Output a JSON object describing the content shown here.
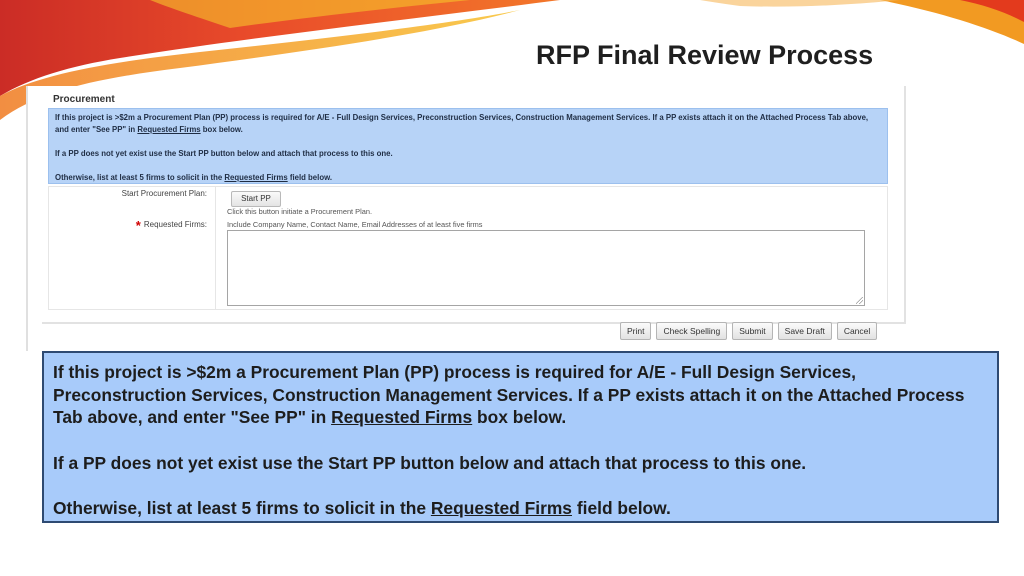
{
  "slide": {
    "title": "RFP Final Review Process"
  },
  "form": {
    "section_title": "Procurement",
    "info": {
      "p1_a": "If this project is >$2m a Procurement Plan (PP) process is required for A/E - Full Design Services, Preconstruction Services, Construction Management Services.  If a PP exists attach it on the Attached Process Tab above, and enter \"See PP\" in ",
      "p1_link": "Requested Firms",
      "p1_b": " box below.",
      "p2": "If a PP does not yet exist use the Start PP button below and attach that process to this one.",
      "p3_a": "Otherwise, list at least 5 firms to solicit in the ",
      "p3_link": "Requested Firms",
      "p3_b": " field below."
    },
    "start_pp_label": "Start Procurement Plan:",
    "start_pp_button": "Start PP",
    "start_pp_hint": "Click this button initiate a Procurement Plan.",
    "required_marker": "*",
    "requested_firms_label": "Requested Firms:",
    "requested_firms_hint": "Include Company Name, Contact Name, Email Addresses of at least five firms",
    "requested_firms_value": "",
    "buttons": {
      "print": "Print",
      "check_spelling": "Check Spelling",
      "submit": "Submit",
      "save_draft": "Save Draft",
      "cancel": "Cancel"
    }
  },
  "callout": {
    "p1_a": "If this project is >$2m a Procurement Plan (PP) process is required for A/E - Full Design Services, Preconstruction Services, Construction Management Services.  If a PP exists attach it on the Attached Process Tab above, and enter \"See PP\" in ",
    "p1_link": "Requested Firms",
    "p1_b": " box below.",
    "p2": "If a PP does not yet exist use the Start PP button below and attach that process to this one.",
    "p3_a": "Otherwise, list at least 5 firms to solicit in the ",
    "p3_link": "Requested Firms",
    "p3_b": " field below."
  },
  "colors": {
    "swoosh_red": "#e8321e",
    "swoosh_orange": "#f39a1e",
    "swoosh_yellow": "#f7c52c",
    "info_bg": "#b7d3f7",
    "callout_bg": "#a8cbfa",
    "callout_border": "#2e4a72"
  }
}
